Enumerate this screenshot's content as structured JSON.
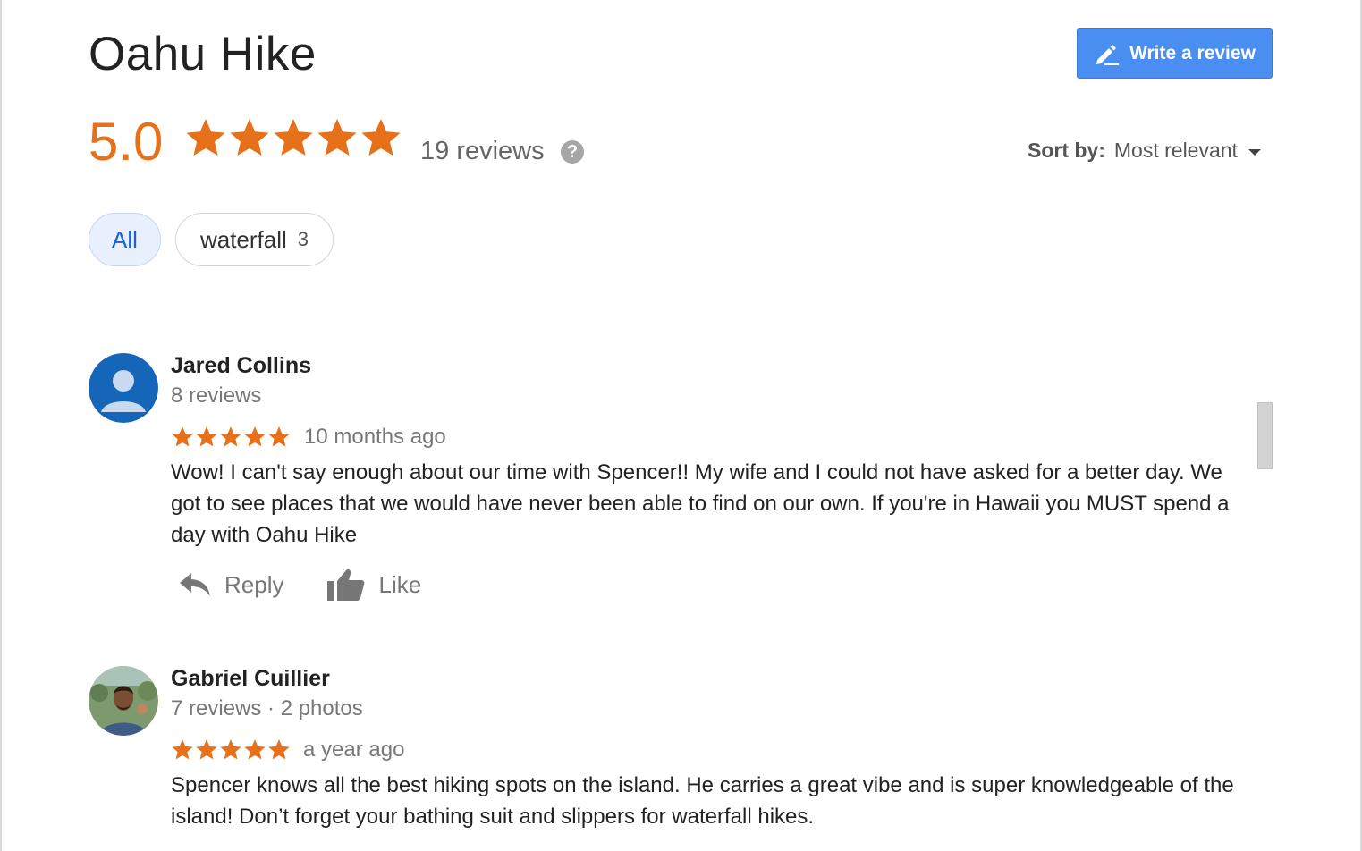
{
  "header": {
    "title": "Oahu Hike",
    "write_review_label": "Write a review",
    "write_review_icon": "pencil-icon"
  },
  "summary": {
    "rating": "5.0",
    "stars": 5,
    "reviews_label": "19 reviews",
    "help_glyph": "?",
    "accent_color": "#e7711b"
  },
  "sort": {
    "label": "Sort by:",
    "value": "Most relevant"
  },
  "filters": [
    {
      "label": "All",
      "selected": true
    },
    {
      "label": "waterfall",
      "count": "3",
      "selected": false
    }
  ],
  "reviews": [
    {
      "name": "Jared Collins",
      "meta": "8 reviews",
      "stars": 5,
      "time": "10 months ago",
      "text": "Wow! I can't say enough about our time with Spencer!! My wife and I could not have asked for a better day. We got to see places that we would have never been able to find on our own. If you're in Hawaii you MUST spend a day with Oahu Hike",
      "reply_label": "Reply",
      "like_label": "Like"
    },
    {
      "name": "Gabriel Cuillier",
      "meta": "7 reviews · 2 photos",
      "stars": 5,
      "time": "a year ago",
      "text": "Spencer knows all the best hiking spots on the island. He carries a great vibe and is super knowledgeable of the island! Don’t forget your bathing suit and slippers for waterfall hikes."
    }
  ],
  "colors": {
    "primary_button": "#4a8ef1",
    "chip_selected_bg": "#e8f0fe",
    "chip_selected_text": "#1a62d4"
  }
}
